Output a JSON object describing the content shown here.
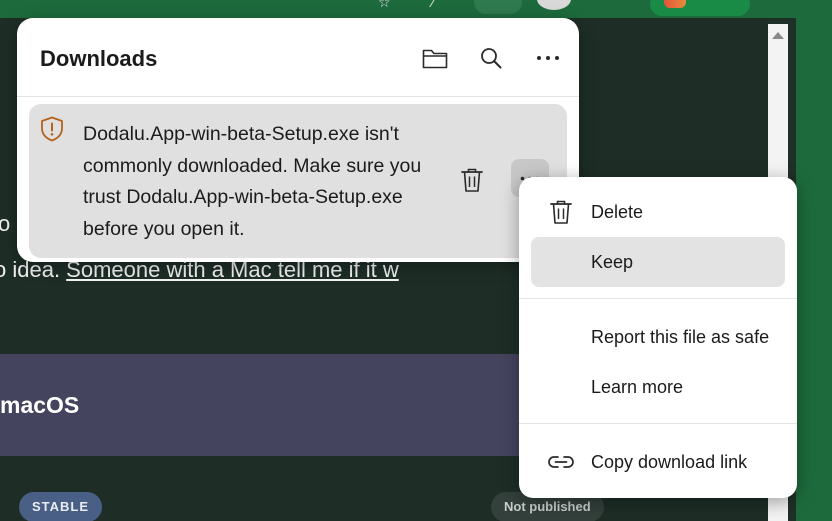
{
  "background": {
    "partial_line_1": "o",
    "partial_line_2_prefix": "o idea. ",
    "partial_line_2_link": "Someone with a Mac tell me if it w",
    "section_title": "macOS",
    "stable_badge": "STABLE",
    "status_badge": "Not published"
  },
  "downloads": {
    "title": "Downloads",
    "header_buttons": [
      {
        "icon": "folder-icon",
        "label": "Open downloads folder"
      },
      {
        "icon": "search-icon",
        "label": "Search downloads"
      },
      {
        "icon": "more-icon",
        "label": "More options"
      }
    ],
    "warning": {
      "icon": "shield-warning-icon",
      "message": "Dodalu.App-win-beta-Setup.exe isn't commonly downloaded. Make sure you trust Dodalu.App-win-beta-Setup.exe before you open it."
    }
  },
  "context_menu": {
    "items": [
      {
        "label": "Delete",
        "icon": "trash-icon"
      },
      {
        "label": "Keep",
        "icon": "",
        "selected": true
      },
      {
        "label": "Report this file as safe",
        "icon": ""
      },
      {
        "label": "Learn more",
        "icon": ""
      },
      {
        "label": "Copy download link",
        "icon": "link-icon"
      }
    ]
  },
  "colors": {
    "browser_frame": "#1d6b3d",
    "page_background": "#1e2e27",
    "macos_section": "#45445f",
    "warning_card": "#e0e0e0",
    "warning_icon": "#b5621b",
    "menu_selected": "#e3e3e3"
  }
}
